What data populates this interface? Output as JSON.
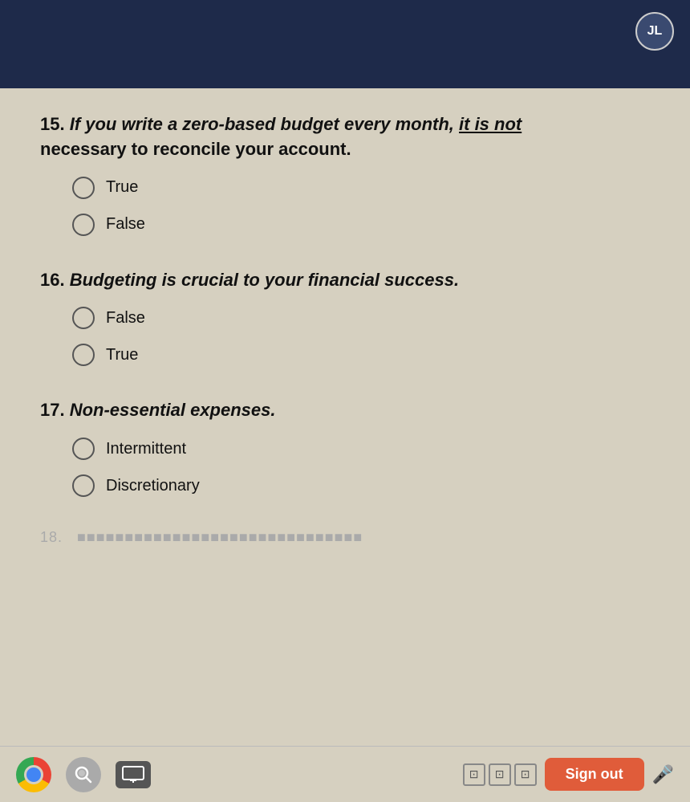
{
  "topBar": {
    "avatarLabel": "JL"
  },
  "questions": [
    {
      "number": "15.",
      "text": "If you write a zero-based budget every month, it is not necessary to reconcile your account.",
      "italicPart": "If you write a zero-based budget every month, it is not",
      "boldRest": "necessary to reconcile your account.",
      "options": [
        {
          "label": "True",
          "selected": false
        },
        {
          "label": "False",
          "selected": false
        }
      ]
    },
    {
      "number": "16.",
      "text": "Budgeting is crucial to your financial success.",
      "options": [
        {
          "label": "False",
          "selected": false
        },
        {
          "label": "True",
          "selected": false
        }
      ]
    },
    {
      "number": "17.",
      "text": "Non-essential expenses.",
      "options": [
        {
          "label": "Intermittent",
          "selected": false
        },
        {
          "label": "Discretionary",
          "selected": false
        }
      ]
    }
  ],
  "partialQuestion": {
    "number": "18.",
    "blurredText": "... ... ... ... ... ... ..."
  },
  "bottomBar": {
    "signOutLabel": "Sign out",
    "pageIndicators": [
      "⊡",
      "⊡",
      "⊡"
    ]
  }
}
